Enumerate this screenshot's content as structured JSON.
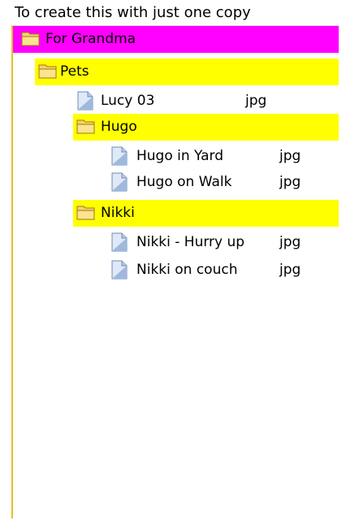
{
  "caption": "To create this with just one copy",
  "tree": {
    "root": {
      "label": "For Grandma",
      "icon": "folder-icon"
    },
    "pets": {
      "label": "Pets",
      "icon": "folder-icon"
    },
    "lucy": {
      "label": "Lucy 03",
      "ext": "jpg",
      "icon": "file-icon"
    },
    "hugo": {
      "label": "Hugo",
      "icon": "folder-icon"
    },
    "hugo_yard": {
      "label": "Hugo in Yard",
      "ext": "jpg",
      "icon": "file-icon"
    },
    "hugo_walk": {
      "label": "Hugo on Walk",
      "ext": "jpg",
      "icon": "file-icon"
    },
    "nikki": {
      "label": "Nikki",
      "icon": "folder-icon"
    },
    "nikki_hurry": {
      "label": "Nikki - Hurry up",
      "ext": "jpg",
      "icon": "file-icon"
    },
    "nikki_couch": {
      "label": "Nikki on couch",
      "ext": "jpg",
      "icon": "file-icon"
    }
  },
  "colors": {
    "root_highlight": "#ff00ff",
    "folder_highlight": "#ffff00",
    "panel_border": "#e3c020"
  }
}
